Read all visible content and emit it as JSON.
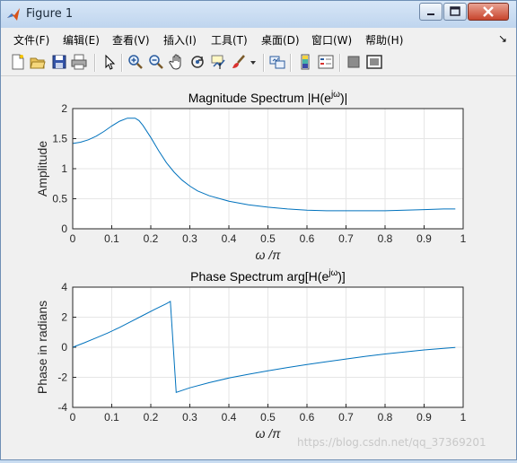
{
  "window": {
    "title": "Figure 1",
    "controls": [
      "minimize",
      "maximize",
      "close"
    ]
  },
  "menu": {
    "items": [
      "文件(F)",
      "编辑(E)",
      "查看(V)",
      "插入(I)",
      "工具(T)",
      "桌面(D)",
      "窗口(W)",
      "帮助(H)"
    ],
    "dock_arrow": "↘"
  },
  "toolbar": {
    "icons": [
      "new-figure-icon",
      "open-file-icon",
      "save-icon",
      "print-icon",
      "pointer-icon",
      "zoom-in-icon",
      "zoom-out-icon",
      "pan-hand-icon",
      "rotate-3d-icon",
      "data-cursor-icon",
      "brush-icon",
      "brush-dropdown-icon",
      "link-plot-icon",
      "colorbar-icon",
      "legend-icon",
      "hide-plot-tools-icon",
      "show-plot-tools-icon"
    ]
  },
  "watermark": "https://blog.csdn.net/qq_37369201",
  "chart_data": [
    {
      "type": "line",
      "title": "Magnitude Spectrum |H(e",
      "title_sup": "jω",
      "title_end": ")|",
      "xlabel": "ω /π",
      "ylabel": "Amplitude",
      "xlim": [
        0,
        1
      ],
      "ylim": [
        0,
        2
      ],
      "xticks": [
        "0",
        "0.1",
        "0.2",
        "0.3",
        "0.4",
        "0.5",
        "0.6",
        "0.7",
        "0.8",
        "0.9",
        "1"
      ],
      "yticks": [
        "0",
        "0.5",
        "1",
        "1.5",
        "2"
      ],
      "grid": true,
      "color": "#0072bd",
      "x": [
        0,
        0.02,
        0.04,
        0.06,
        0.08,
        0.1,
        0.12,
        0.14,
        0.16,
        0.17,
        0.18,
        0.2,
        0.22,
        0.24,
        0.26,
        0.28,
        0.3,
        0.32,
        0.35,
        0.4,
        0.45,
        0.5,
        0.55,
        0.6,
        0.65,
        0.7,
        0.75,
        0.8,
        0.85,
        0.9,
        0.95,
        0.98
      ],
      "y": [
        1.42,
        1.44,
        1.48,
        1.54,
        1.62,
        1.71,
        1.79,
        1.84,
        1.84,
        1.8,
        1.72,
        1.52,
        1.3,
        1.1,
        0.94,
        0.81,
        0.71,
        0.63,
        0.55,
        0.46,
        0.4,
        0.36,
        0.33,
        0.31,
        0.3,
        0.3,
        0.3,
        0.3,
        0.31,
        0.32,
        0.33,
        0.33
      ]
    },
    {
      "type": "line",
      "title": "Phase Spectrum arg[H(e",
      "title_sup": "jω",
      "title_end": ")]",
      "xlabel": "ω /π",
      "ylabel": "Phase in radians",
      "xlim": [
        0,
        1
      ],
      "ylim": [
        -4,
        4
      ],
      "xticks": [
        "0",
        "0.1",
        "0.2",
        "0.3",
        "0.4",
        "0.5",
        "0.6",
        "0.7",
        "0.8",
        "0.9",
        "1"
      ],
      "yticks": [
        "-4",
        "-2",
        "0",
        "2",
        "4"
      ],
      "grid": true,
      "color": "#0072bd",
      "x": [
        0,
        0.03,
        0.06,
        0.09,
        0.12,
        0.15,
        0.18,
        0.21,
        0.24,
        0.25,
        0.265,
        0.3,
        0.35,
        0.4,
        0.45,
        0.5,
        0.55,
        0.6,
        0.65,
        0.7,
        0.75,
        0.8,
        0.85,
        0.9,
        0.95,
        0.98
      ],
      "y": [
        0,
        0.3,
        0.62,
        0.95,
        1.32,
        1.72,
        2.12,
        2.52,
        2.9,
        3.05,
        -3.0,
        -2.7,
        -2.35,
        -2.05,
        -1.8,
        -1.57,
        -1.35,
        -1.15,
        -0.96,
        -0.78,
        -0.6,
        -0.45,
        -0.31,
        -0.18,
        -0.07,
        -0.02
      ]
    }
  ]
}
